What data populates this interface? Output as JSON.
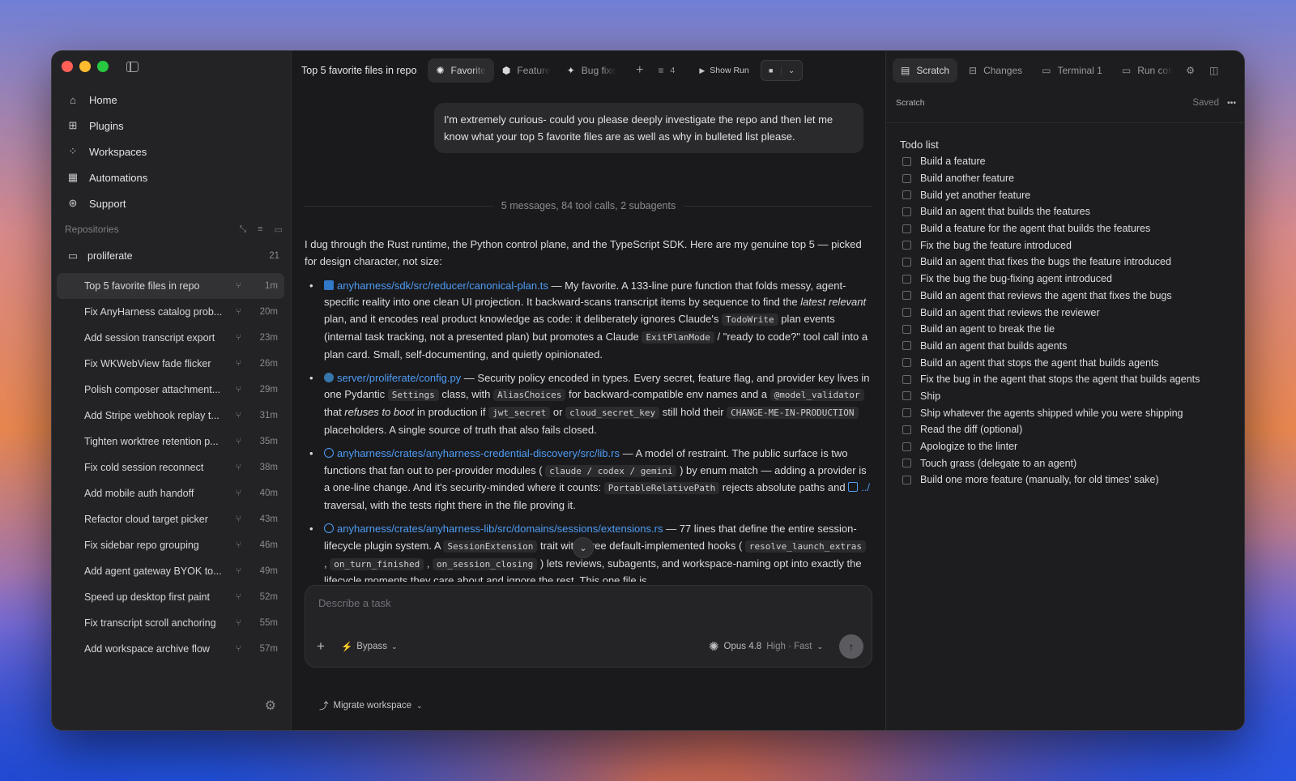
{
  "window": {
    "traffic_colors": [
      "#ff5f57",
      "#febc2e",
      "#28c840"
    ]
  },
  "sidebar": {
    "nav": [
      {
        "label": "Home",
        "icon": "home-icon"
      },
      {
        "label": "Plugins",
        "icon": "plugins-icon"
      },
      {
        "label": "Workspaces",
        "icon": "workspaces-icon"
      },
      {
        "label": "Automations",
        "icon": "automations-icon"
      },
      {
        "label": "Support",
        "icon": "support-icon"
      }
    ],
    "repositories_label": "Repositories",
    "repo": {
      "name": "proliferate",
      "count": "21"
    },
    "tasks": [
      {
        "title": "Top 5 favorite files in repo",
        "time": "1m"
      },
      {
        "title": "Fix AnyHarness catalog prob...",
        "time": "20m"
      },
      {
        "title": "Add session transcript export",
        "time": "23m"
      },
      {
        "title": "Fix WKWebView fade flicker",
        "time": "26m"
      },
      {
        "title": "Polish composer attachment...",
        "time": "29m"
      },
      {
        "title": "Add Stripe webhook replay t...",
        "time": "31m"
      },
      {
        "title": "Tighten worktree retention p...",
        "time": "35m"
      },
      {
        "title": "Fix cold session reconnect",
        "time": "38m"
      },
      {
        "title": "Add mobile auth handoff",
        "time": "40m"
      },
      {
        "title": "Refactor cloud target picker",
        "time": "43m"
      },
      {
        "title": "Fix sidebar repo grouping",
        "time": "46m"
      },
      {
        "title": "Add agent gateway BYOK to...",
        "time": "49m"
      },
      {
        "title": "Speed up desktop first paint",
        "time": "52m"
      },
      {
        "title": "Fix transcript scroll anchoring",
        "time": "55m"
      },
      {
        "title": "Add workspace archive flow",
        "time": "57m"
      }
    ]
  },
  "chat": {
    "title": "Top 5 favorite files in repo",
    "tabs": [
      "Favorite",
      "Feature",
      "Bug fixe"
    ],
    "filter_count": "4",
    "show_run": "Show Run",
    "user_message": "I'm extremely curious- could you please deeply investigate the repo and then let me know what your top 5 favorite files are as well as why in bulleted list please.",
    "summary": "5 messages, 84 tool calls, 2 subagents",
    "reply_intro": "I dug through the Rust runtime, the Python control plane, and the TypeScript SDK. Here are my genuine top 5 — picked for design character, not size:",
    "items": [
      {
        "file": "anyharness/sdk/src/reducer/canonical-plan.ts"
      },
      {
        "file": "server/proliferate/config.py"
      },
      {
        "file": "anyharness/crates/anyharness-credential-discovery/src/lib.rs"
      },
      {
        "file": "anyharness/crates/anyharness-lib/src/domains/sessions/extensions.rs"
      }
    ],
    "t1a": " — My favorite. A 133-line pure function that folds messy, agent-specific reality into one clean UI projection. It backward-scans transcript items by sequence to find the ",
    "t1b": "latest relevant",
    "t1c": " plan, and it encodes real product knowledge as code: it deliberately ignores Claude's ",
    "c1a": "TodoWrite",
    "t1d": " plan events (internal task tracking, not a presented plan) but promotes a Claude ",
    "c1b": "ExitPlanMode",
    "t1e": " / \"ready to code?\" tool call into a plan card. Small, self-documenting, and quietly opinionated.",
    "t2a": " — Security policy encoded in types. Every secret, feature flag, and provider key lives in one Pydantic ",
    "c2a": "Settings",
    "t2b": " class, with ",
    "c2b": "AliasChoices",
    "t2c": " for backward-compatible env names and a ",
    "c2c": "@model_validator",
    "t2d": " that ",
    "t2e": "refuses to boot",
    "t2f": " in production if ",
    "c2d": "jwt_secret",
    "t2g": " or ",
    "c2e": "cloud_secret_key",
    "t2h": " still hold their ",
    "c2f": "CHANGE-ME-IN-PRODUCTION",
    "t2i": " placeholders. A single source of truth that also fails closed.",
    "t3a": " — A model of restraint. The public surface is two functions that fan out to per-provider modules ( ",
    "c3a": "claude / codex / gemini",
    "t3b": " ) by enum match — adding a provider is a one-line change. And it's security-minded where it counts: ",
    "c3b": "PortableRelativePath",
    "t3c": " rejects absolute paths and ",
    "t3d": "../",
    "t3e": " traversal, with the tests right there in the file proving it.",
    "t4a": " — 77 lines that define the entire session-lifecycle plugin system. A ",
    "c4a": "SessionExtension",
    "t4b": " trait with three default-implemented hooks ( ",
    "c4b": "resolve_launch_extras",
    "t4c": " , ",
    "c4c": "on_turn_finished",
    "t4d": " , ",
    "c4d": "on_session_closing",
    "t4e": " ) lets reviews, subagents, and workspace-naming opt into exactly the lifecycle moments they care about and ignore the rest. This one file is",
    "composer_placeholder": "Describe a task",
    "mode": "Bypass",
    "model": "Opus 4.8",
    "model_opts": "High · Fast",
    "migrate": "Migrate workspace"
  },
  "right": {
    "tabs": [
      "Scratch",
      "Changes",
      "Terminal 1",
      "Run com"
    ],
    "panel_title": "Scratch",
    "saved": "Saved",
    "todo_title": "Todo list",
    "todos": [
      "Build a feature",
      "Build another feature",
      "Build yet another feature",
      "Build an agent that builds the features",
      "Build a feature for the agent that builds the features",
      "Fix the bug the feature introduced",
      "Build an agent that fixes the bugs the feature introduced",
      "Fix the bug the bug-fixing agent introduced",
      "Build an agent that reviews the agent that fixes the bugs",
      "Build an agent that reviews the reviewer",
      "Build an agent to break the tie",
      "Build an agent that builds agents",
      "Build an agent that stops the agent that builds agents",
      "Fix the bug in the agent that stops the agent that builds agents",
      "Ship",
      "Ship whatever the agents shipped while you were shipping",
      "Read the diff (optional)",
      "Apologize to the linter",
      "Touch grass (delegate to an agent)",
      "Build one more feature (manually, for old times' sake)"
    ]
  }
}
